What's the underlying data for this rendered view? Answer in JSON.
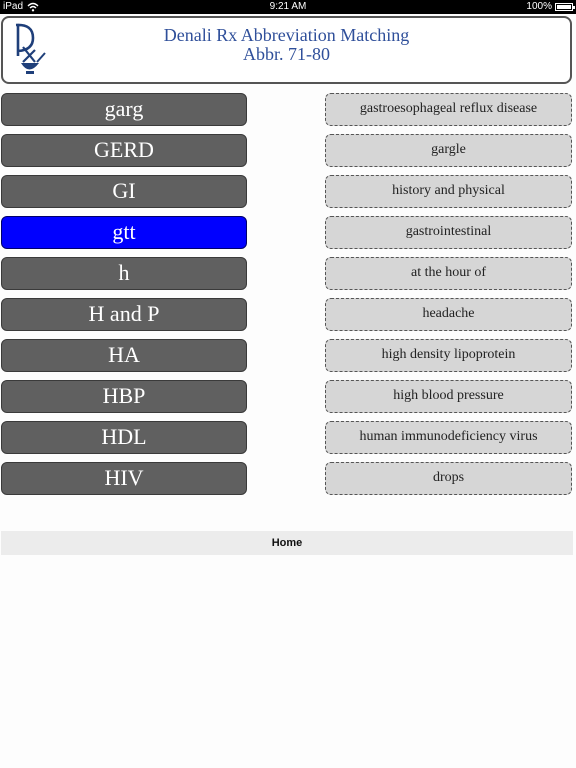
{
  "status_bar": {
    "carrier": "iPad",
    "time": "9:21 AM",
    "battery": "100%"
  },
  "header": {
    "title": "Denali Rx Abbreviation Matching",
    "subtitle": "Abbr. 71-80"
  },
  "abbreviations": [
    {
      "label": "garg",
      "selected": false
    },
    {
      "label": "GERD",
      "selected": false
    },
    {
      "label": "GI",
      "selected": false
    },
    {
      "label": "gtt",
      "selected": true
    },
    {
      "label": "h",
      "selected": false
    },
    {
      "label": "H and P",
      "selected": false
    },
    {
      "label": "HA",
      "selected": false
    },
    {
      "label": "HBP",
      "selected": false
    },
    {
      "label": "HDL",
      "selected": false
    },
    {
      "label": "HIV",
      "selected": false
    }
  ],
  "definitions": [
    "gastroesophageal reflux disease",
    "gargle",
    "history and physical",
    "gastrointestinal",
    "at the hour of",
    "headache",
    "high density lipoprotein",
    "high blood pressure",
    "human immunodeficiency virus",
    "drops"
  ],
  "footer": {
    "home_label": "Home"
  },
  "colors": {
    "selected": "#0000ff",
    "button": "#606060",
    "definition_bg": "#d6d6d6",
    "title": "#2f4f9a"
  }
}
